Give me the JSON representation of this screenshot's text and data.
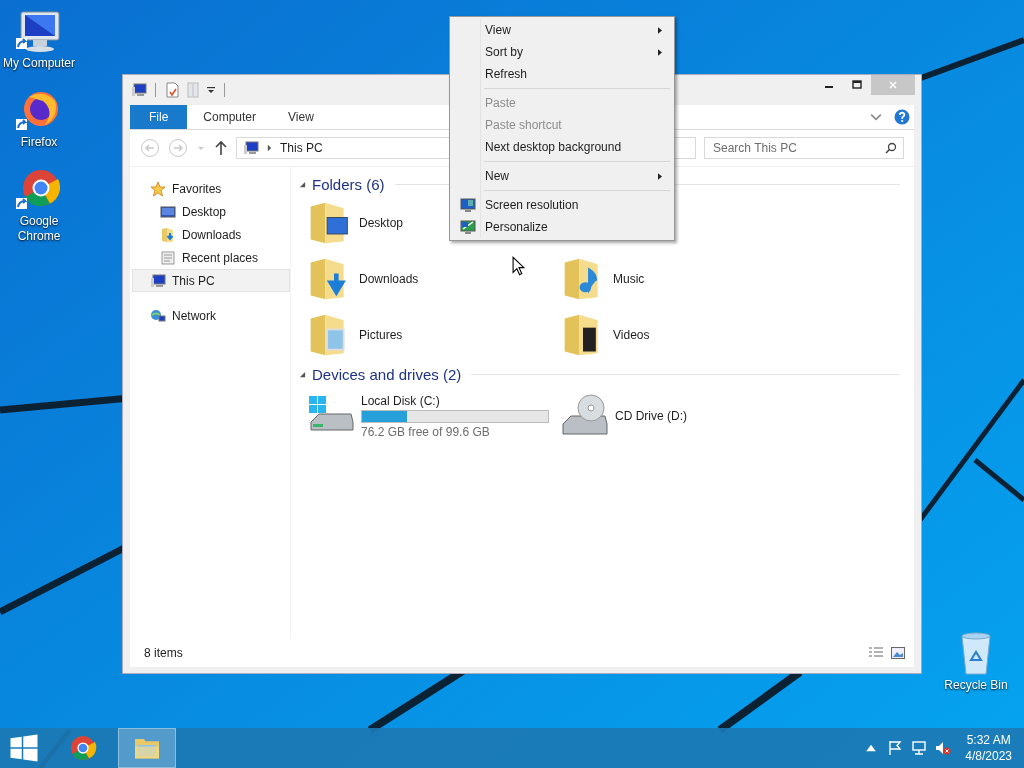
{
  "desktop_icons": [
    {
      "label": "My Computer",
      "kind": "computer"
    },
    {
      "label": "Firefox",
      "kind": "firefox"
    },
    {
      "label": "Google Chrome",
      "kind": "chrome"
    },
    {
      "label": "Recycle Bin",
      "kind": "recycle"
    }
  ],
  "window": {
    "ribbon_tabs": [
      {
        "label": "File",
        "selected": true
      },
      {
        "label": "Computer",
        "selected": false
      },
      {
        "label": "View",
        "selected": false
      }
    ],
    "address": "This PC",
    "search": {
      "placeholder": "Search This PC"
    },
    "nav": [
      {
        "label": "Favorites",
        "kind": "star",
        "selected": false,
        "children": [
          {
            "label": "Desktop",
            "kind": "desktop",
            "selected": false
          },
          {
            "label": "Downloads",
            "kind": "downloads",
            "selected": false
          },
          {
            "label": "Recent places",
            "kind": "recent",
            "selected": false
          }
        ]
      },
      {
        "label": "This PC",
        "kind": "pc",
        "selected": true
      },
      {
        "label": "Network",
        "kind": "network",
        "selected": false
      }
    ],
    "folders": {
      "title": "Folders (6)",
      "items": [
        {
          "label": "Desktop",
          "kind": "desktop"
        },
        {
          "label": "Downloads",
          "kind": "downloads"
        },
        {
          "label": "Music",
          "kind": "music"
        },
        {
          "label": "Pictures",
          "kind": "pictures"
        },
        {
          "label": "Videos",
          "kind": "videos"
        }
      ]
    },
    "drives": {
      "title": "Devices and drives (2)",
      "items": [
        {
          "label": "Local Disk (C:)",
          "kind": "disk",
          "level": 0.24,
          "free": "76.2 GB free of 99.6 GB"
        },
        {
          "label": "CD Drive (D:)",
          "kind": "cd"
        }
      ]
    },
    "status_bar": "8 items"
  },
  "context_menu": {
    "sections": [
      [
        {
          "label": "View",
          "kind": "plain",
          "submenu": true,
          "disabled": false
        },
        {
          "label": "Sort by",
          "kind": "plain",
          "submenu": true,
          "disabled": false
        },
        {
          "label": "Refresh",
          "kind": "plain",
          "submenu": false,
          "disabled": false
        }
      ],
      [
        {
          "label": "Paste",
          "kind": "plain",
          "submenu": false,
          "disabled": true
        },
        {
          "label": "Paste shortcut",
          "kind": "plain",
          "submenu": false,
          "disabled": true
        },
        {
          "label": "Next desktop background",
          "kind": "plain",
          "submenu": false,
          "disabled": false
        }
      ],
      [
        {
          "label": "New",
          "kind": "plain",
          "submenu": true,
          "disabled": false
        }
      ],
      [
        {
          "label": "Screen resolution",
          "kind": "display",
          "submenu": false,
          "disabled": false
        },
        {
          "label": "Personalize",
          "kind": "personalize",
          "submenu": false,
          "disabled": false
        }
      ]
    ]
  },
  "taskbar": {
    "apps": [
      {
        "kind": "chrome",
        "selected": false
      },
      {
        "kind": "explorer",
        "selected": true
      }
    ],
    "time": "5:32 AM",
    "date": "4/8/2023"
  }
}
